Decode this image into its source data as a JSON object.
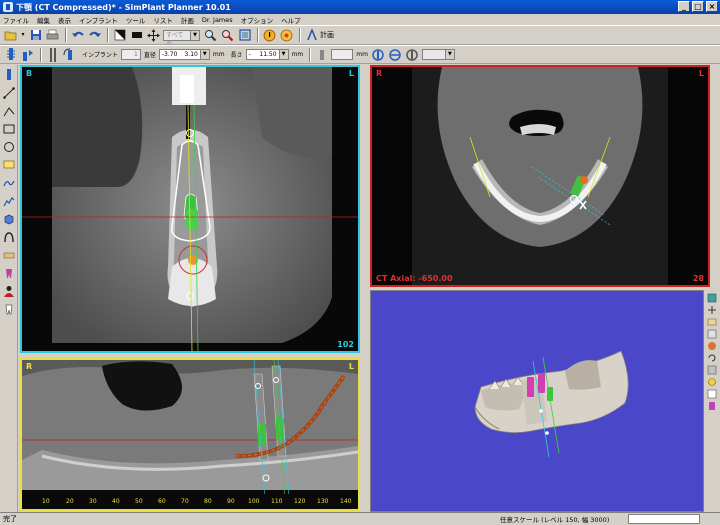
{
  "window": {
    "title": "下顎 (CT Compressed)* - SimPlant Planner 10.01",
    "min_label": "_",
    "max_label": "□",
    "close_label": "×"
  },
  "menu": [
    "ファイル",
    "編集",
    "表示",
    "インプラント",
    "ツール",
    "リスト",
    "計画",
    "Dr. James",
    "オプション",
    "ヘルプ"
  ],
  "toolbar1": {
    "view_combo": "すべての",
    "plan_label": "計画"
  },
  "toolbar2": {
    "implant_label": "インプラント",
    "implant_value": "1",
    "diameter_label": "直径",
    "diameter_value": "-3.70",
    "diameter2_value": "3.10",
    "diameter_unit": "mm",
    "length_label": "長さ",
    "length_sign": "-",
    "length_value": "11.50",
    "length_unit": "mm",
    "field_a_unit": "mm"
  },
  "views": {
    "cross": {
      "left_marker": "B",
      "right_marker": "L",
      "slice": "102"
    },
    "axial": {
      "left_marker": "R",
      "right_marker": "L",
      "caption": "CT Axial: -650.00",
      "slice": "28"
    },
    "pano": {
      "left_marker": "R",
      "right_marker": "L",
      "ruler": [
        "10",
        "20",
        "30",
        "40",
        "50",
        "60",
        "70",
        "80",
        "90",
        "100",
        "110",
        "120",
        "130",
        "140"
      ]
    }
  },
  "status": {
    "left": "完了",
    "scale": "任意スケール (レベル 150, 幅 3000)"
  },
  "colors": {
    "cross_border": "#30c8e0",
    "axial_border": "#d02020",
    "pano_border": "#e8e040",
    "viewport_3d_bg": "#4a48c8",
    "implant_green": "#40c040",
    "nerve_canal": "#a0481a"
  }
}
